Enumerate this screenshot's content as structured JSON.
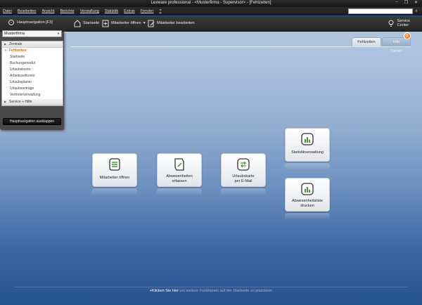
{
  "window": {
    "title": "Lexware professional - <Musterfirma - Supervisor> - [Fehlzeiten]",
    "controls": [
      "–",
      "❐",
      "✕"
    ]
  },
  "menu": [
    "Datei",
    "Bearbeiten",
    "Ansicht",
    "Berichte",
    "Verwaltung",
    "Statistik",
    "Extras",
    "Fenster",
    "?"
  ],
  "search": {
    "placeholder": ""
  },
  "toolbar": {
    "home_label": "Startseite",
    "open_employee_label": "Mitarbeiter öffnen",
    "edit_employee_label": "Mitarbeiter bearbeiten",
    "service_center_label": "Service Center"
  },
  "navigator": {
    "title": "Hauptnavigation [F3]",
    "company": "Musterfirma",
    "groups": [
      {
        "label": "Zentrale"
      },
      {
        "label": "Fehlzeiten"
      },
      {
        "label": "Service + Hilfe"
      }
    ],
    "subitems": [
      "Startseite",
      "Buchungsmodul",
      "Urlaubskonto",
      "Arbeitszeitkonto",
      "Urlaubsplaner",
      "Urlaubsanträge",
      "Vertreterverwaltung"
    ],
    "collapse_label": "Hauptnavigation ausklappen"
  },
  "tabs": [
    "Fehlzeiten",
    "Info Center"
  ],
  "info_badge": "!",
  "tiles": {
    "open_employee": "Mitarbeiter öffnen",
    "absences_1": "Abwesenheiten",
    "absences_2": "erfassen",
    "leave_card_1": "Urlaubskarte",
    "leave_card_2": "per E-Mail",
    "statistics": "Statistikverwaltung",
    "absence_list_1": "Abwesenheitsliste",
    "absence_list_2": "drucken"
  },
  "footer": {
    "link": "+Klicken Sie hier",
    "rest": " um weitere Funktionen auf der Startseite zu platzieren"
  },
  "colors": {
    "accent": "#e46a10",
    "tile_icon_green": "#4a9b2d"
  }
}
